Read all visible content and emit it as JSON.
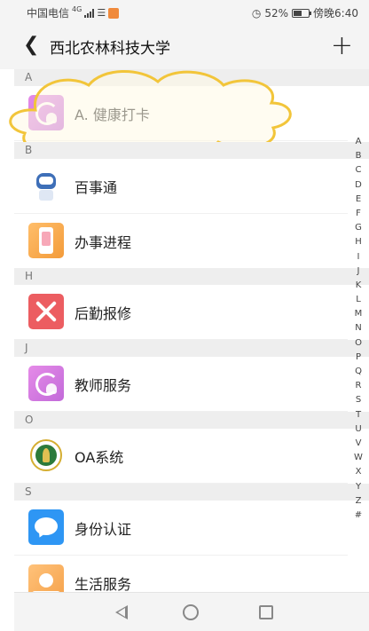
{
  "status_bar": {
    "carrier": "中国电信",
    "network": "4G",
    "battery": "52%",
    "time": "傍晚6:40"
  },
  "header": {
    "title": "西北农林科技大学",
    "back_icon": "chevron-left-icon",
    "add_icon": "plus-icon"
  },
  "sections": [
    {
      "letter": "A",
      "items": [
        {
          "label": "A. 健康打卡",
          "icon": "clock-person-icon",
          "color": "#d77ae0"
        }
      ]
    },
    {
      "letter": "B",
      "items": [
        {
          "label": "百事通",
          "icon": "robot-icon",
          "color": "#3e6fb8"
        },
        {
          "label": "办事进程",
          "icon": "phone-form-icon",
          "color": "#f6a64a"
        }
      ]
    },
    {
      "letter": "H",
      "items": [
        {
          "label": "后勤报修",
          "icon": "tools-icon",
          "color": "#ec5d61"
        }
      ]
    },
    {
      "letter": "J",
      "items": [
        {
          "label": "教师服务",
          "icon": "clock-person-icon",
          "color": "#d77ae0"
        }
      ]
    },
    {
      "letter": "O",
      "items": [
        {
          "label": "OA系统",
          "icon": "university-seal-icon",
          "color": "#2c7a3a"
        }
      ]
    },
    {
      "letter": "S",
      "items": [
        {
          "label": "身份认证",
          "icon": "chat-bubble-icon",
          "color": "#2e96f4"
        },
        {
          "label": "生活服务",
          "icon": "palm-sun-icon",
          "color": "#f5a24b"
        }
      ]
    }
  ],
  "alphabet_index": [
    "A",
    "B",
    "C",
    "D",
    "E",
    "F",
    "G",
    "H",
    "I",
    "J",
    "K",
    "L",
    "M",
    "N",
    "O",
    "P",
    "Q",
    "R",
    "S",
    "T",
    "U",
    "V",
    "W",
    "X",
    "Y",
    "Z",
    "#"
  ],
  "nav_bar": {
    "back_icon": "triangle-back-icon",
    "home_icon": "circle-home-icon",
    "recent_icon": "square-recent-icon"
  }
}
